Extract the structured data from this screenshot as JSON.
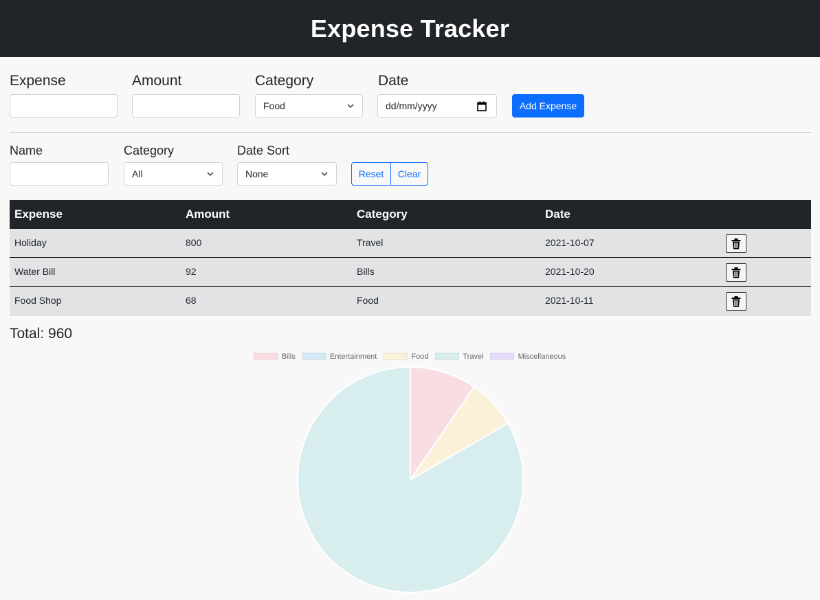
{
  "header": {
    "title": "Expense Tracker"
  },
  "add_form": {
    "expense_label": "Expense",
    "expense_value": "",
    "amount_label": "Amount",
    "amount_value": "",
    "category_label": "Category",
    "category_selected": "Food",
    "date_label": "Date",
    "date_placeholder": "dd/mm/yyyy",
    "add_button": "Add Expense"
  },
  "filters": {
    "name_label": "Name",
    "name_value": "",
    "category_label": "Category",
    "category_selected": "All",
    "date_sort_label": "Date Sort",
    "date_sort_selected": "None",
    "reset_button": "Reset",
    "clear_button": "Clear"
  },
  "table": {
    "headers": [
      "Expense",
      "Amount",
      "Category",
      "Date"
    ],
    "rows": [
      {
        "expense": "Holiday",
        "amount": "800",
        "category": "Travel",
        "date": "2021-10-07"
      },
      {
        "expense": "Water Bill",
        "amount": "92",
        "category": "Bills",
        "date": "2021-10-20"
      },
      {
        "expense": "Food Shop",
        "amount": "68",
        "category": "Food",
        "date": "2021-10-11"
      }
    ]
  },
  "total": "Total: 960",
  "chart_data": {
    "type": "pie",
    "labels": [
      "Bills",
      "Entertainment",
      "Food",
      "Travel",
      "Miscellaneous"
    ],
    "values": [
      92,
      0,
      68,
      800,
      0
    ],
    "colors": [
      "#fadde3",
      "#d6e9f7",
      "#fbf0d8",
      "#d8eded",
      "#e5dcfb"
    ],
    "legend_position": "top"
  }
}
